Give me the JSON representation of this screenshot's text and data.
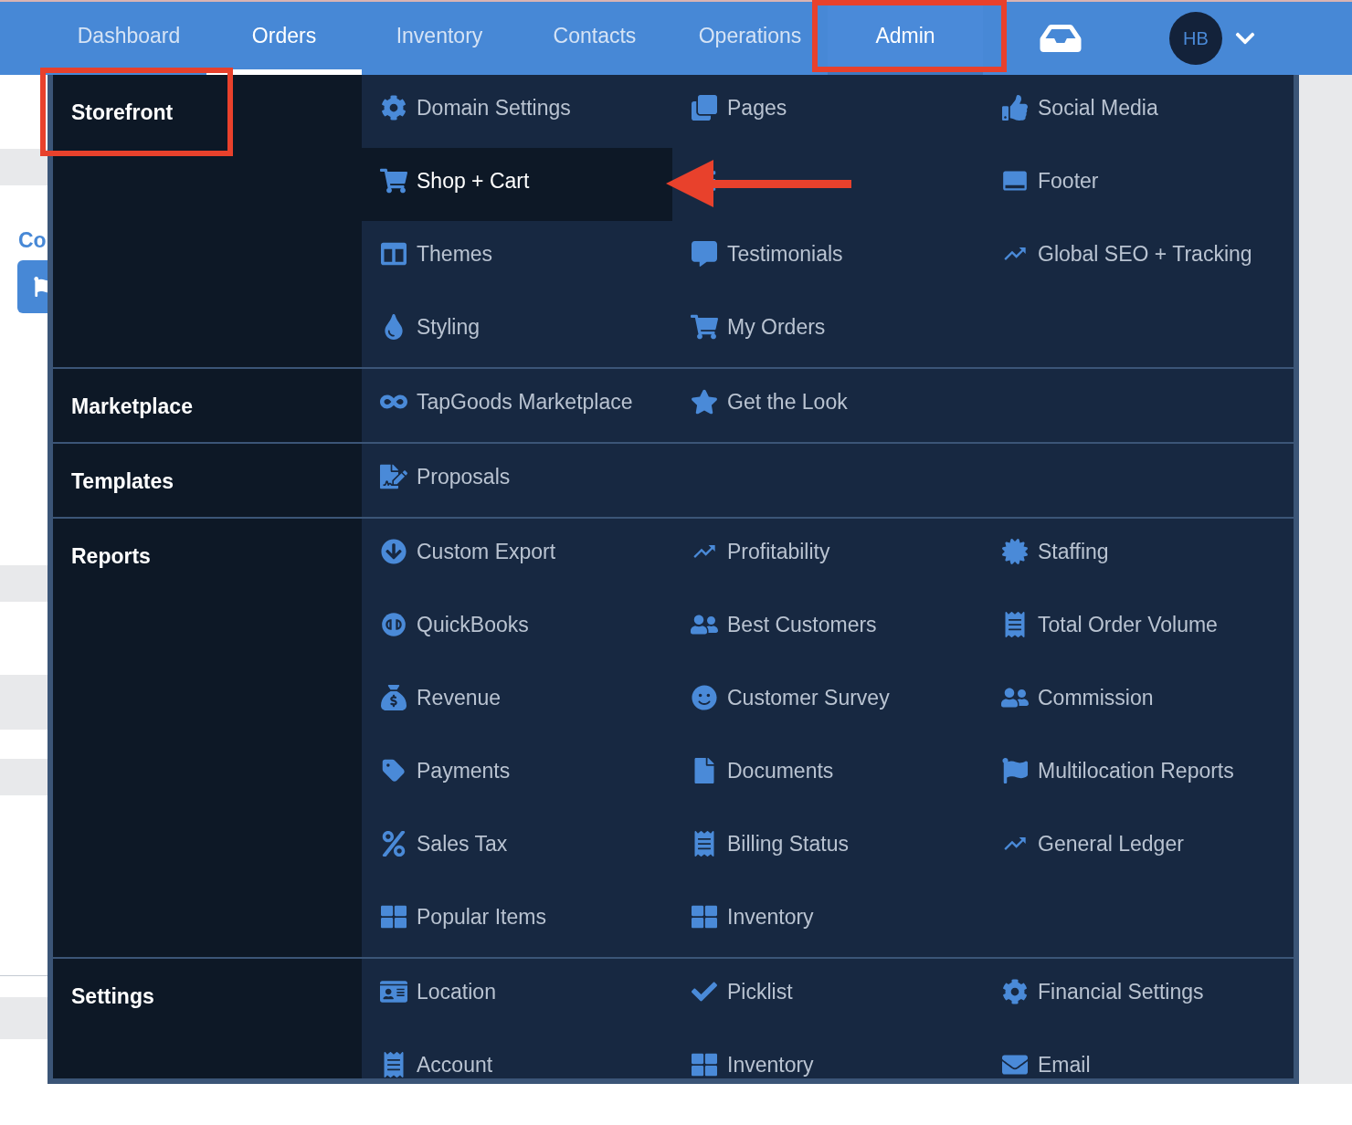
{
  "nav": {
    "tabs": [
      {
        "label": "Dashboard",
        "selected": false,
        "open": false
      },
      {
        "label": "Orders",
        "selected": true,
        "open": false
      },
      {
        "label": "Inventory",
        "selected": false,
        "open": false
      },
      {
        "label": "Contacts",
        "selected": false,
        "open": false
      },
      {
        "label": "Operations",
        "selected": false,
        "open": false
      },
      {
        "label": "Admin",
        "selected": false,
        "open": true
      }
    ],
    "avatar": "HB"
  },
  "page": {
    "heading": "Co"
  },
  "menu": {
    "sections": [
      {
        "label": "Storefront",
        "items": [
          {
            "label": "Domain Settings",
            "selected": false
          },
          {
            "label": "Pages",
            "selected": false
          },
          {
            "label": "Social Media",
            "selected": false
          },
          {
            "label": "Shop + Cart",
            "selected": true
          },
          {
            "selected": false
          },
          {
            "label": "Footer",
            "selected": false
          },
          {
            "label": "Themes",
            "selected": false
          },
          {
            "label": "Testimonials",
            "selected": false
          },
          {
            "label": "Global SEO + Tracking",
            "selected": false
          },
          {
            "label": "Styling",
            "selected": false
          },
          {
            "label": "My Orders",
            "selected": false
          }
        ]
      },
      {
        "label": "Marketplace",
        "items": [
          {
            "label": "TapGoods Marketplace",
            "selected": false
          },
          {
            "label": "Get the Look",
            "selected": false
          }
        ]
      },
      {
        "label": "Templates",
        "items": [
          {
            "label": "Proposals",
            "selected": false
          }
        ]
      },
      {
        "label": "Reports",
        "items": [
          {
            "label": "Custom Export",
            "selected": false
          },
          {
            "label": "Profitability",
            "selected": false
          },
          {
            "label": "Staffing",
            "selected": false
          },
          {
            "label": "QuickBooks",
            "selected": false
          },
          {
            "label": "Best Customers",
            "selected": false
          },
          {
            "label": "Total Order Volume",
            "selected": false
          },
          {
            "label": "Revenue",
            "selected": false
          },
          {
            "label": "Customer Survey",
            "selected": false
          },
          {
            "label": "Commission",
            "selected": false
          },
          {
            "label": "Payments",
            "selected": false
          },
          {
            "label": "Documents",
            "selected": false
          },
          {
            "label": "Multilocation Reports",
            "selected": false
          },
          {
            "label": "Sales Tax",
            "selected": false
          },
          {
            "label": "Billing Status",
            "selected": false
          },
          {
            "label": "General Ledger",
            "selected": false
          },
          {
            "label": "Popular Items",
            "selected": false
          },
          {
            "label": "Inventory",
            "selected": false
          }
        ]
      },
      {
        "label": "Settings",
        "items": [
          {
            "label": "Location",
            "selected": false
          },
          {
            "label": "Picklist",
            "selected": false
          },
          {
            "label": "Financial Settings",
            "selected": false
          },
          {
            "label": "Account",
            "selected": false
          },
          {
            "label": "Inventory",
            "selected": false
          },
          {
            "label": "Email",
            "selected": false
          }
        ]
      }
    ]
  }
}
